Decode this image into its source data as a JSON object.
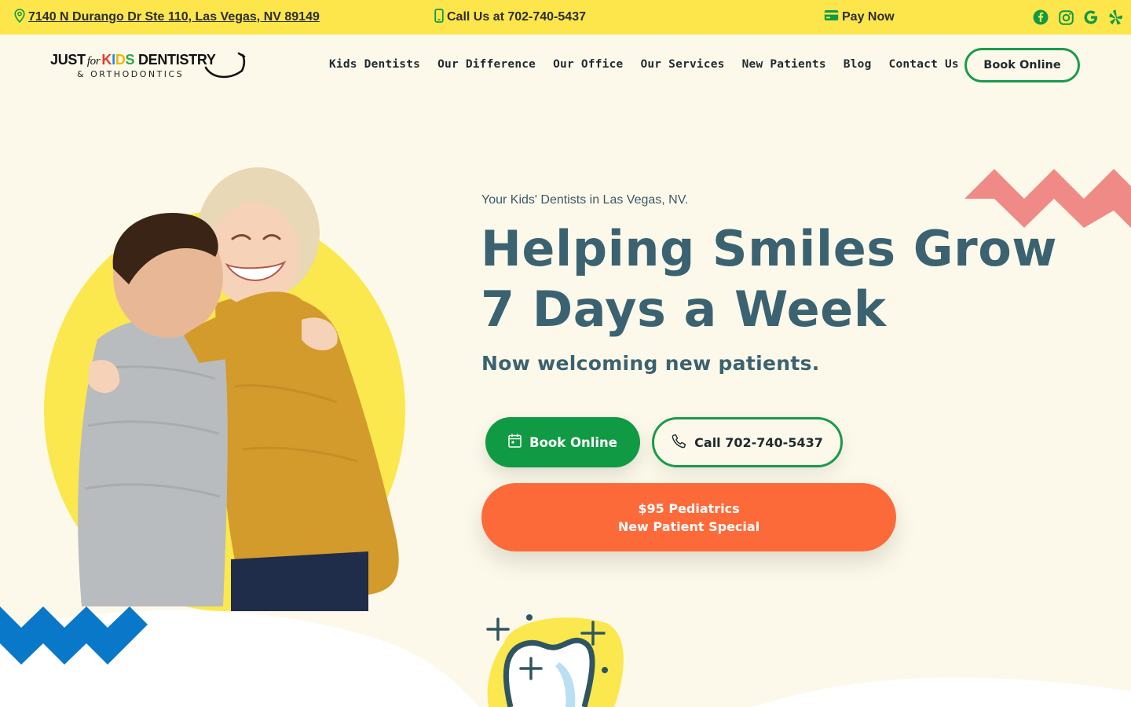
{
  "topbar": {
    "address": "7140 N Durango Dr Ste 110, Las Vegas, NV 89149",
    "phone": "Call Us at 702-740-5437",
    "pay": "Pay Now",
    "social": [
      "facebook-icon",
      "instagram-icon",
      "google-icon",
      "yelp-icon"
    ],
    "background": "#fde64b"
  },
  "logo": {
    "just": "JUST",
    "for": "for",
    "kids": "KIDS",
    "dentistry": "DENTISTRY",
    "ortho": "& ORTHODONTICS"
  },
  "nav": {
    "items": [
      "Kids Dentists",
      "Our Difference",
      "Our Office",
      "Our Services",
      "New Patients",
      "Blog",
      "Contact Us"
    ],
    "book": "Book Online"
  },
  "hero": {
    "eyebrow": "Your Kids' Dentists in Las Vegas, NV.",
    "headline_line1": "Helping Smiles Grow",
    "headline_line2": "7 Days a Week",
    "subhead": "Now welcoming new patients.",
    "book_button": "Book Online",
    "call_button": "Call 702-740-5437",
    "special_line1": "$95 Pediatrics",
    "special_line2": "New Patient Special"
  },
  "colors": {
    "green": "#119a44",
    "orange": "#fd6a3a",
    "teal_text": "#3b6270",
    "yellow": "#fbe74e",
    "pink": "#f08a86",
    "blue": "#0a78c8",
    "background": "#fdf9ea"
  }
}
